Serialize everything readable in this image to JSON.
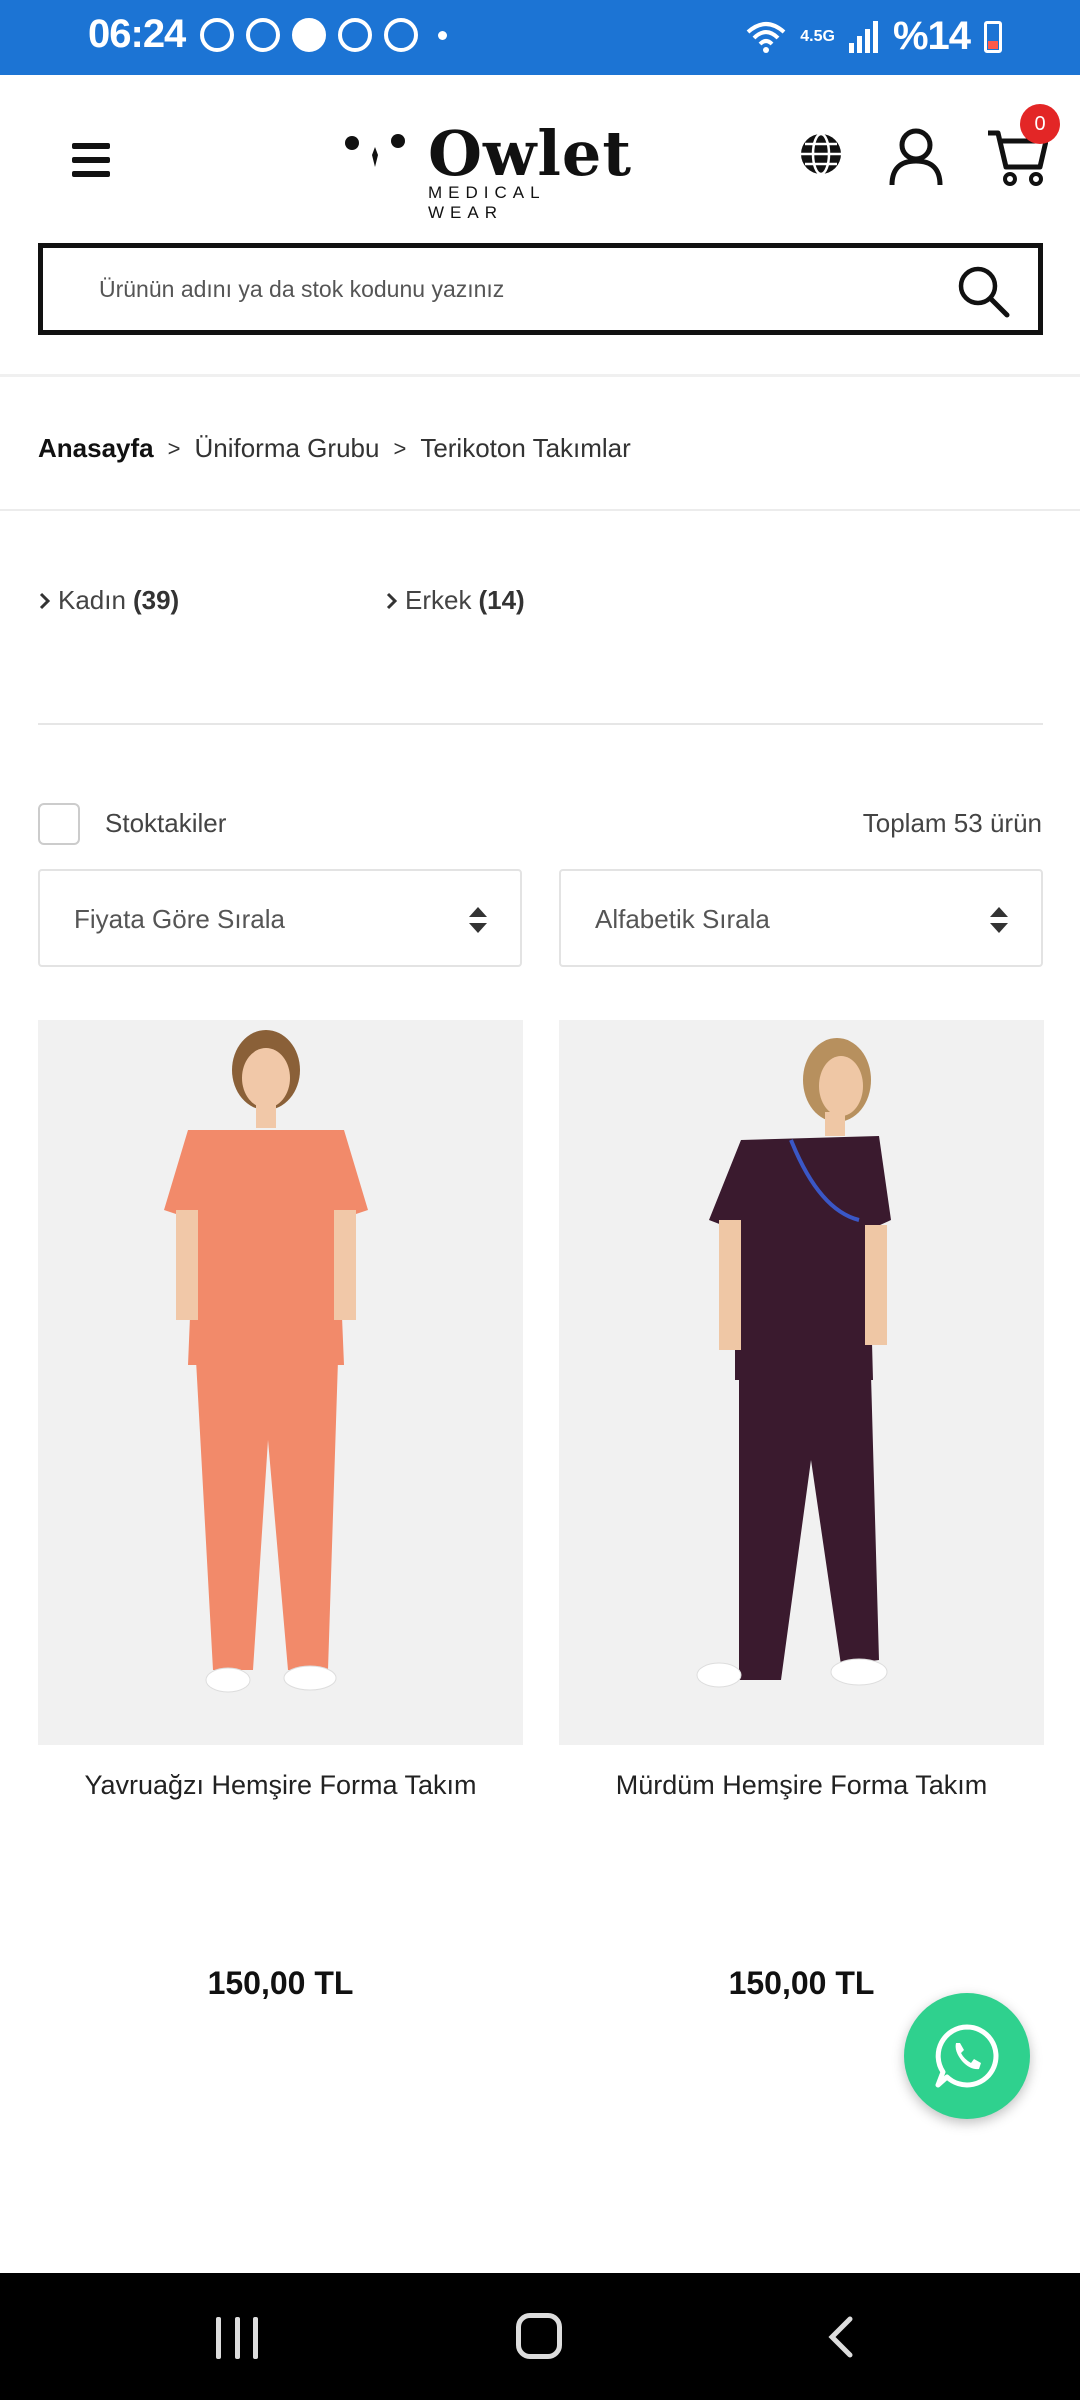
{
  "status_bar": {
    "time": "06:24",
    "network": "4.5G",
    "battery": "%14"
  },
  "header": {
    "logo_name": "Owlet",
    "logo_sub": "MEDICAL WEAR",
    "cart_count": "0"
  },
  "search": {
    "placeholder": "Ürünün adını ya da stok kodunu yazınız"
  },
  "breadcrumb": {
    "items": [
      "Anasayfa",
      "Üniforma Grubu",
      "Terikoton Takımlar"
    ],
    "separator": ">"
  },
  "categories": [
    {
      "label": "Kadın",
      "count": "(39)"
    },
    {
      "label": "Erkek",
      "count": "(14)"
    }
  ],
  "filters": {
    "in_stock_label": "Stoktakiler",
    "total_text": "Toplam 53 ürün",
    "sort_price": "Fiyata Göre Sırala",
    "sort_alpha": "Alfabetik Sırala"
  },
  "products": [
    {
      "name": "Yavruağzı Hemşire Forma Takım",
      "price": "150,00 TL",
      "color": "#f28a6a"
    },
    {
      "name": "Mürdüm Hemşire Forma Takım",
      "price": "150,00 TL",
      "color": "#3a1a2e"
    }
  ],
  "colors": {
    "status_bar": "#1c74d4",
    "badge": "#e32626",
    "whatsapp": "#2fd18e"
  }
}
